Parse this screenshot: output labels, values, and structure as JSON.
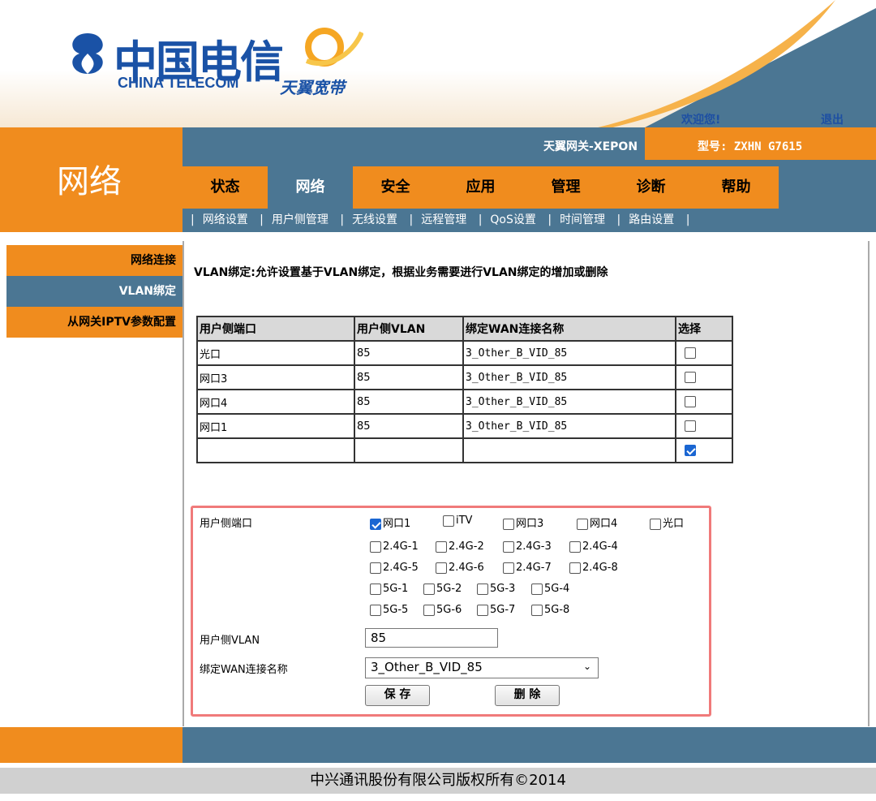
{
  "header": {
    "logo_cn": "中国电信",
    "logo_en": "CHINA TELECOM",
    "tianyi": "天翼宽带",
    "welcome": "欢迎您!",
    "logout": "退出"
  },
  "title_bar": {
    "section_title": "网络",
    "gateway": "天翼网关-XEPON",
    "model": "型号: ZXHN G7615"
  },
  "main_nav": [
    "状态",
    "网络",
    "安全",
    "应用",
    "管理",
    "诊断",
    "帮助"
  ],
  "main_nav_active": "网络",
  "sub_nav": [
    "网络设置",
    "用户侧管理",
    "无线设置",
    "远程管理",
    "QoS设置",
    "时间管理",
    "路由设置"
  ],
  "sidebar": [
    "网络连接",
    "VLAN绑定",
    "从网关IPTV参数配置"
  ],
  "sidebar_active": "VLAN绑定",
  "description": "VLAN绑定:允许设置基于VLAN绑定，根据业务需要进行VLAN绑定的增加或删除",
  "table": {
    "headers": [
      "用户侧端口",
      "用户侧VLAN",
      "绑定WAN连接名称",
      "选择"
    ],
    "rows": [
      {
        "port": "光口",
        "vlan": "85",
        "wan": "3_Other_B_VID_85",
        "selected": false
      },
      {
        "port": "网口3",
        "vlan": "85",
        "wan": "3_Other_B_VID_85",
        "selected": false
      },
      {
        "port": "网口4",
        "vlan": "85",
        "wan": "3_Other_B_VID_85",
        "selected": false
      },
      {
        "port": "网口1",
        "vlan": "85",
        "wan": "3_Other_B_VID_85",
        "selected": false
      },
      {
        "port": "",
        "vlan": "",
        "wan": "",
        "selected": true
      }
    ]
  },
  "form": {
    "port_label": "用户侧端口",
    "ports_row1": [
      {
        "label": "网口1",
        "checked": true
      },
      {
        "label": "iTV",
        "checked": false
      },
      {
        "label": "网口3",
        "checked": false
      },
      {
        "label": "网口4",
        "checked": false
      },
      {
        "label": "光口",
        "checked": false
      }
    ],
    "wifi_rows": [
      [
        "2.4G-1",
        "2.4G-2",
        "2.4G-3",
        "2.4G-4"
      ],
      [
        "2.4G-5",
        "2.4G-6",
        "2.4G-7",
        "2.4G-8"
      ],
      [
        "5G-1",
        "5G-2",
        "5G-3",
        "5G-4"
      ],
      [
        "5G-5",
        "5G-6",
        "5G-7",
        "5G-8"
      ]
    ],
    "vlan_label": "用户侧VLAN",
    "vlan_value": "85",
    "wan_label": "绑定WAN连接名称",
    "wan_value": "3_Other_B_VID_85",
    "save_label": "保 存",
    "delete_label": "删 除"
  },
  "footer": {
    "copyright": "中兴通讯股份有限公司版权所有©2014"
  },
  "colors": {
    "orange": "#f08c1e",
    "steel_blue": "#4b7693",
    "brand_blue": "#1a52a6",
    "checkbox_blue": "#1a66d2",
    "highlight_border": "#f07a7a"
  }
}
